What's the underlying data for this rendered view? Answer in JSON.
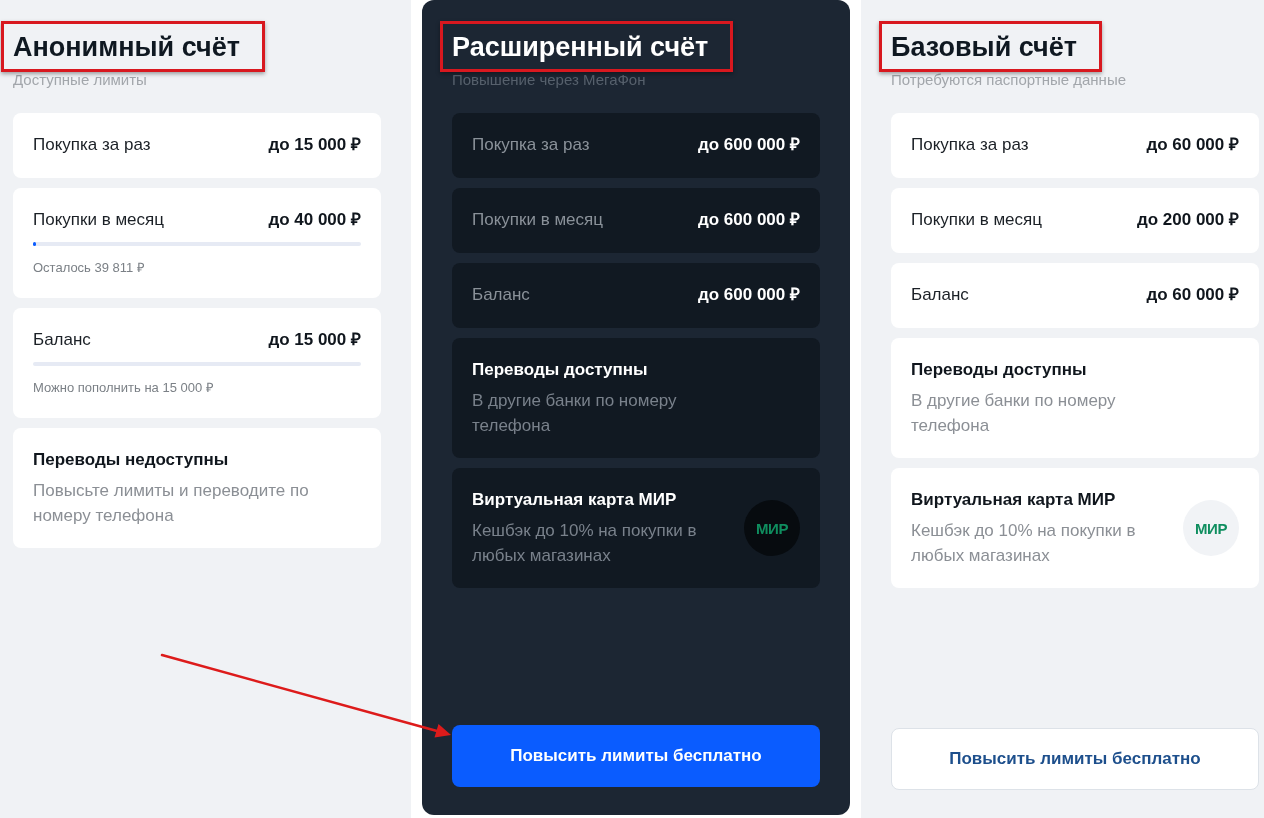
{
  "columns": [
    {
      "featured": false,
      "title": "Анонимный счёт",
      "title_marked": true,
      "subtitle": "Доступные лимиты",
      "cards": [
        {
          "kind": "limit",
          "label": "Покупка за раз",
          "value": "до 15 000 ₽"
        },
        {
          "kind": "limit",
          "label": "Покупки в месяц",
          "value": "до 40 000 ₽",
          "level": 0.01,
          "note": "Осталось 39 811 ₽"
        },
        {
          "kind": "limit",
          "label": "Баланс",
          "value": "до 15 000 ₽",
          "level": 0,
          "note": "Можно пополнить на 15 000 ₽"
        },
        {
          "kind": "info",
          "title": "Переводы недоступны",
          "text": "Повысьте лимиты и переводите по номеру телефона"
        }
      ]
    },
    {
      "featured": true,
      "title": "Расширенный счёт",
      "title_marked": true,
      "subtitle": "Повышение через МегаФон",
      "cards": [
        {
          "kind": "limit",
          "label": "Покупка за раз",
          "value": "до 600 000 ₽"
        },
        {
          "kind": "limit",
          "label": "Покупки в месяц",
          "value": "до 600 000 ₽"
        },
        {
          "kind": "limit",
          "label": "Баланс",
          "value": "до 600 000 ₽"
        },
        {
          "kind": "info",
          "title": "Переводы доступны",
          "text": "В другие банки по номеру телефона"
        },
        {
          "kind": "info",
          "title": "Виртуальная карта МИР",
          "text": "Кешбэк до 10% на покупки в любых магазинах",
          "logo": "МИР"
        }
      ],
      "button": {
        "kind": "primary",
        "label": "Повысить лимиты бесплатно",
        "arrow_pointed": true
      }
    },
    {
      "featured": false,
      "title": "Базовый счёт",
      "title_marked": true,
      "subtitle": "Потребуются паспортные данные",
      "cards": [
        {
          "kind": "limit",
          "label": "Покупка за раз",
          "value": "до 60 000 ₽"
        },
        {
          "kind": "limit",
          "label": "Покупки в месяц",
          "value": "до 200 000 ₽"
        },
        {
          "kind": "limit",
          "label": "Баланс",
          "value": "до 60 000 ₽"
        },
        {
          "kind": "info",
          "title": "Переводы доступны",
          "text": "В другие банки по номеру телефона"
        },
        {
          "kind": "info",
          "title": "Виртуальная карта МИР",
          "text": "Кешбэк до 10% на покупки в любых магазинах",
          "logo": "МИР"
        }
      ],
      "button": {
        "kind": "outline",
        "label": "Повысить лимиты бесплатно",
        "arrow_pointed": false
      }
    }
  ]
}
